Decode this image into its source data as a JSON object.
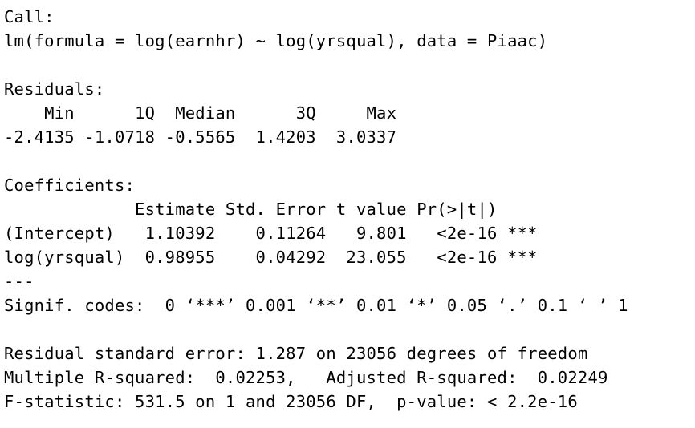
{
  "call": {
    "header": "Call:",
    "formula": "lm(formula = log(earnhr) ~ log(yrsqual), data = Piaac)"
  },
  "residuals": {
    "header": "Residuals:",
    "labels": "    Min      1Q  Median      3Q     Max ",
    "values": "-2.4135 -1.0718 -0.5565  1.4203  3.0337 "
  },
  "coefficients": {
    "header": "Coefficients:",
    "column_headers": "             Estimate Std. Error t value Pr(>|t|)    ",
    "rows": [
      "(Intercept)   1.10392    0.11264   9.801   <2e-16 ***",
      "log(yrsqual)  0.98955    0.04292  23.055   <2e-16 ***"
    ],
    "separator": "---",
    "signif_codes": "Signif. codes:  0 ‘***’ 0.001 ‘**’ 0.01 ‘*’ 0.05 ‘.’ 0.1 ‘ ’ 1"
  },
  "summary": {
    "rse": "Residual standard error: 1.287 on 23056 degrees of freedom",
    "r_squared": "Multiple R-squared:  0.02253,\tAdjusted R-squared:  0.02249 ",
    "f_statistic": "F-statistic: 531.5 on 1 and 23056 DF,  p-value: < 2.2e-16"
  }
}
